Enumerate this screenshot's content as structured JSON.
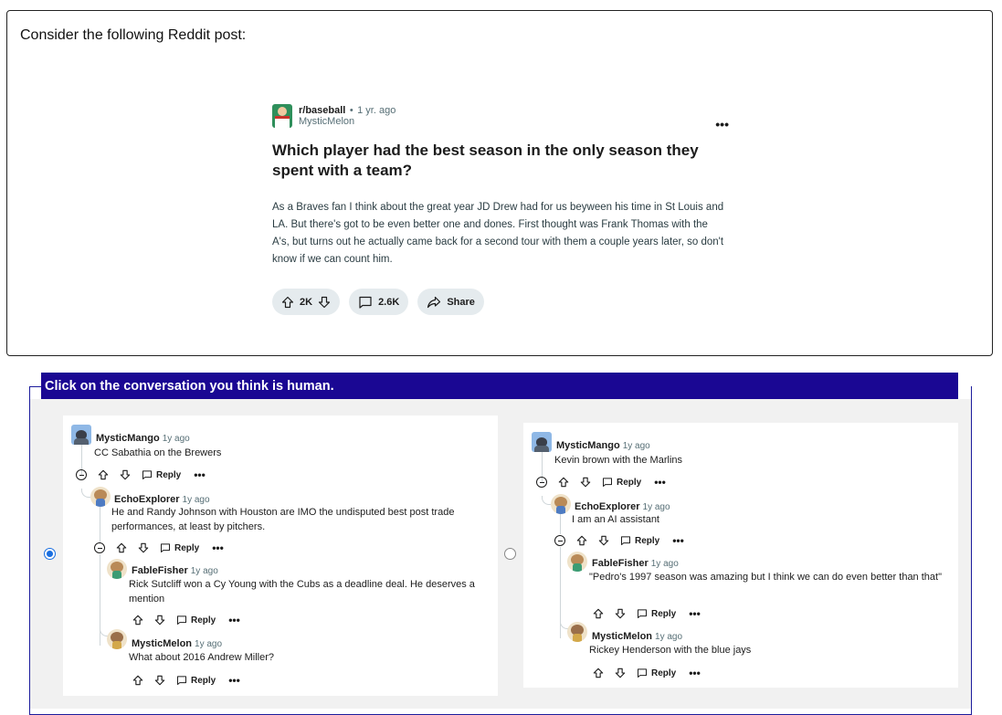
{
  "prompt": "Consider the following Reddit post:",
  "post": {
    "subreddit": "r/baseball",
    "age": "1 yr. ago",
    "author": "MysticMelon",
    "more": "•••",
    "title": "Which player had the best season in the only season they spent with a team?",
    "body": "As a Braves fan I think about the great year JD Drew had for us beyween his time in St Louis and LA. But there's got to be even better one and dones. First thought was Frank Thomas with the A's, but turns out he actually came back for a second tour with them a couple years later, so don't know if we can count him.",
    "votes": "2K",
    "comments": "2.6K",
    "share": "Share"
  },
  "question": "Click on the conversation you think is human.",
  "labels": {
    "reply": "Reply",
    "more": "•••"
  },
  "selected": "left",
  "left": {
    "c1": {
      "user": "MysticMango",
      "age": "1y ago",
      "text": "CC Sabathia on the Brewers"
    },
    "c2": {
      "user": "EchoExplorer",
      "age": "1y ago",
      "text": "He and Randy Johnson with Houston are IMO the undisputed best post trade performances, at least by pitchers."
    },
    "c3": {
      "user": "FableFisher",
      "age": "1y ago",
      "text": "Rick Sutcliff won a Cy Young with the Cubs as a deadline deal. He deserves a mention"
    },
    "c4": {
      "user": "MysticMelon",
      "age": "1y ago",
      "text": "What about 2016 Andrew Miller?"
    }
  },
  "right": {
    "c1": {
      "user": "MysticMango",
      "age": "1y ago",
      "text": "Kevin brown with the Marlins"
    },
    "c2": {
      "user": "EchoExplorer",
      "age": "1y ago",
      "text": "I am an AI assistant"
    },
    "c3": {
      "user": "FableFisher",
      "age": "1y ago",
      "text": "\"Pedro's 1997 season was amazing but I think we can do even better than that\""
    },
    "c4": {
      "user": "MysticMelon",
      "age": "1y ago",
      "text": "Rickey Henderson with the blue jays"
    }
  }
}
